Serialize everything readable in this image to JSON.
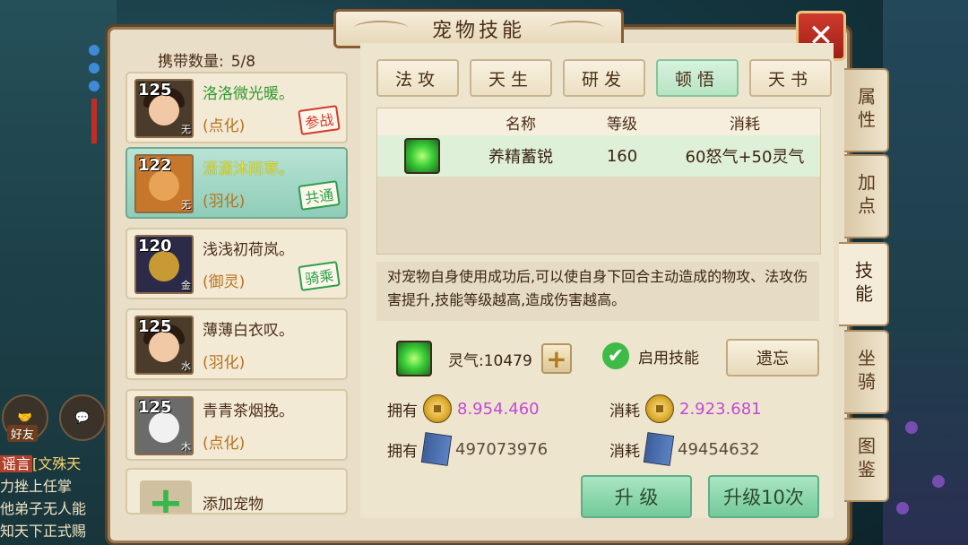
{
  "window": {
    "title": "宠物技能",
    "close_label": "✕"
  },
  "pets": {
    "carry_label": "携带数量:",
    "carry_count": "5/8",
    "items": [
      {
        "level": "125",
        "element": "无",
        "name": "洛洛微光暖。",
        "type": "(点化)",
        "badge": "参战",
        "badge_color": "#d23a2d"
      },
      {
        "level": "122",
        "element": "无",
        "name": "潇潇沐雨寒。",
        "type": "(羽化)",
        "badge": "共通",
        "badge_color": "#2d9e4d"
      },
      {
        "level": "120",
        "element": "金",
        "name": "浅浅初荷岚。",
        "type": "(御灵)",
        "badge": "骑乘",
        "badge_color": "#2d9e4d"
      },
      {
        "level": "125",
        "element": "水",
        "name": "薄薄白衣叹。",
        "type": "(羽化)",
        "badge": ""
      },
      {
        "level": "125",
        "element": "木",
        "name": "青青茶烟挽。",
        "type": "(点化)",
        "badge": ""
      }
    ],
    "add_label": "添加宠物"
  },
  "tabs": [
    "法攻",
    "天生",
    "研发",
    "顿悟",
    "天书"
  ],
  "active_tab": "顿悟",
  "side_tabs": [
    "属性",
    "加点",
    "技能",
    "坐骑",
    "图鉴"
  ],
  "active_side_tab": "技能",
  "skill_table": {
    "headers": [
      "名称",
      "等级",
      "消耗"
    ],
    "rows": [
      {
        "name": "养精蓄锐",
        "level": "160",
        "cost": "60怒气+50灵气"
      }
    ]
  },
  "description": "对宠物自身使用成功后,可以使自身下回合主动造成的物攻、法攻伤害提升,技能等级越高,造成伤害越高。",
  "aura": {
    "label": "灵气:10479",
    "enable_label": "启用技能",
    "forget_label": "遗忘"
  },
  "resources": {
    "own_label": "拥有",
    "cost_label": "消耗",
    "coin_own": "8.954.460",
    "coin_cost": "2.923.681",
    "book_own": "497073976",
    "book_cost": "49454632"
  },
  "buttons": {
    "upgrade": "升 级",
    "upgrade10": "升级10次"
  },
  "hud": {
    "friend_label": "好友",
    "chat_lines": [
      "谣言",
      "[文殊天",
      "力挫上任掌",
      "他弟子无人能",
      "知天下正式赐"
    ]
  }
}
